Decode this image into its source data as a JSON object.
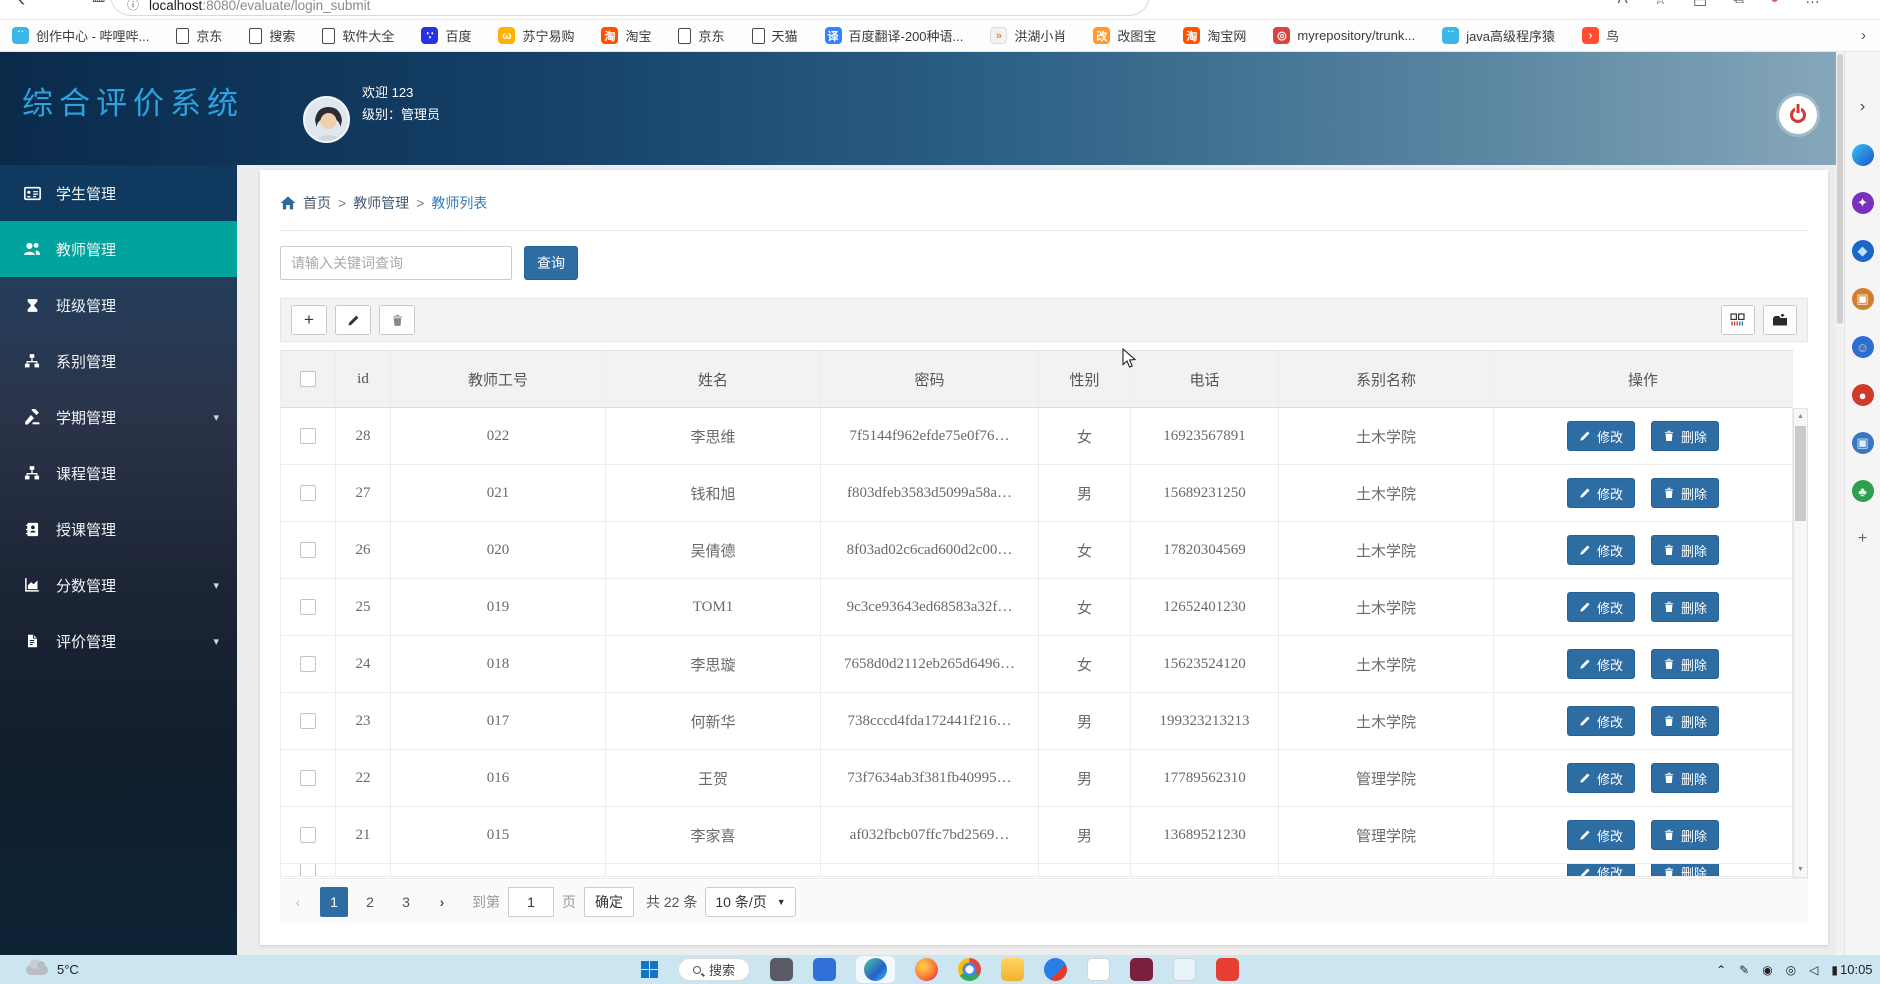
{
  "browser": {
    "url_host": "localhost",
    "url_rest": ":8080/evaluate/login_submit",
    "bookmarks": [
      {
        "label": "创作中心 - 哔哩哔...",
        "icon": "bilibili",
        "bg": "#3bb7e6",
        "glyph": "˙˙"
      },
      {
        "label": "京东",
        "icon": "page",
        "bg": "",
        "glyph": ""
      },
      {
        "label": "搜索",
        "icon": "page",
        "bg": "",
        "glyph": ""
      },
      {
        "label": "软件大全",
        "icon": "page",
        "bg": "",
        "glyph": ""
      },
      {
        "label": "百度",
        "icon": "baidu-paw",
        "bg": "#2932e1",
        "glyph": "∵"
      },
      {
        "label": "苏宁易购",
        "icon": "suning-lion",
        "bg": "#ffb300",
        "glyph": "ω"
      },
      {
        "label": "淘宝",
        "icon": "taobao",
        "bg": "#ff5000",
        "glyph": "淘"
      },
      {
        "label": "京东",
        "icon": "page",
        "bg": "",
        "glyph": ""
      },
      {
        "label": "天猫",
        "icon": "page",
        "bg": "",
        "glyph": ""
      },
      {
        "label": "百度翻译-200种语...",
        "icon": "translate",
        "bg": "#3385ff",
        "glyph": "译"
      },
      {
        "label": "洪湖小肖",
        "icon": "goose",
        "bg": "#f2f2f2",
        "glyph": "»"
      },
      {
        "label": "改图宝",
        "icon": "gaitubao",
        "bg": "#ff9a2e",
        "glyph": "改"
      },
      {
        "label": "淘宝网",
        "icon": "taobao",
        "bg": "#ff5000",
        "glyph": "淘"
      },
      {
        "label": "myrepository/trunk...",
        "icon": "sphere",
        "bg": "#d8453c",
        "glyph": "◎"
      },
      {
        "label": "java高级程序猿",
        "icon": "bilibili",
        "bg": "#3bb7e6",
        "glyph": "˙˙"
      },
      {
        "label": "鸟",
        "icon": "bird",
        "bg": "#ff4d2e",
        "glyph": "›"
      }
    ],
    "overflow_chevron": "›",
    "top_icons": [
      "A",
      "☆",
      "⬒",
      "⧉",
      "●",
      "…"
    ]
  },
  "header": {
    "title": "综合评价系统",
    "welcome": "欢迎 123",
    "level": "级别：管理员"
  },
  "sidebar": {
    "items": [
      {
        "label": "学生管理",
        "icon": "idcard",
        "style": "navy",
        "caret": false
      },
      {
        "label": "教师管理",
        "icon": "users",
        "style": "active",
        "caret": false
      },
      {
        "label": "班级管理",
        "icon": "hourglass",
        "style": "",
        "caret": false
      },
      {
        "label": "系别管理",
        "icon": "sitemap",
        "style": "",
        "caret": false
      },
      {
        "label": "学期管理",
        "icon": "gavel",
        "style": "",
        "caret": true
      },
      {
        "label": "课程管理",
        "icon": "sitemap",
        "style": "",
        "caret": false
      },
      {
        "label": "授课管理",
        "icon": "addressbook",
        "style": "",
        "caret": false
      },
      {
        "label": "分数管理",
        "icon": "chart",
        "style": "",
        "caret": true
      },
      {
        "label": "评价管理",
        "icon": "file",
        "style": "",
        "caret": true
      }
    ]
  },
  "page": {
    "breadcrumb": {
      "items": [
        "首页",
        "教师管理",
        "教师列表"
      ],
      "separator": ">"
    },
    "search": {
      "placeholder": "请输入关键词查询",
      "button": "查询"
    },
    "table": {
      "columns": [
        "",
        "id",
        "教师工号",
        "姓名",
        "密码",
        "性别",
        "电话",
        "系别名称",
        "操作"
      ],
      "rows": [
        {
          "id": "28",
          "work_no": "022",
          "name": "李思维",
          "password": "7f5144f962efde75e0f76…",
          "gender": "女",
          "phone": "16923567891",
          "dept": "土木学院"
        },
        {
          "id": "27",
          "work_no": "021",
          "name": "钱和旭",
          "password": "f803dfeb3583d5099a58a…",
          "gender": "男",
          "phone": "15689231250",
          "dept": "土木学院"
        },
        {
          "id": "26",
          "work_no": "020",
          "name": "吴倩德",
          "password": "8f03ad02c6cad600d2c00…",
          "gender": "女",
          "phone": "17820304569",
          "dept": "土木学院"
        },
        {
          "id": "25",
          "work_no": "019",
          "name": "TOM1",
          "password": "9c3ce93643ed68583a32f…",
          "gender": "女",
          "phone": "12652401230",
          "dept": "土木学院"
        },
        {
          "id": "24",
          "work_no": "018",
          "name": "李思璇",
          "password": "7658d0d2112eb265d6496…",
          "gender": "女",
          "phone": "15623524120",
          "dept": "土木学院"
        },
        {
          "id": "23",
          "work_no": "017",
          "name": "何新华",
          "password": "738cccd4fda172441f216…",
          "gender": "男",
          "phone": "199323213213",
          "dept": "土木学院"
        },
        {
          "id": "22",
          "work_no": "016",
          "name": "王贺",
          "password": "73f7634ab3f381fb40995…",
          "gender": "男",
          "phone": "17789562310",
          "dept": "管理学院"
        },
        {
          "id": "21",
          "work_no": "015",
          "name": "李家喜",
          "password": "af032fbcb07ffc7bd2569…",
          "gender": "男",
          "phone": "13689521230",
          "dept": "管理学院"
        }
      ],
      "actions": {
        "edit": "修改",
        "delete": "删除"
      }
    },
    "pagination": {
      "prev": "‹",
      "next": "›",
      "pages": [
        "1",
        "2",
        "3"
      ],
      "active": "1",
      "goto_label": "到第",
      "goto_value": "1",
      "unit_label": "页",
      "confirm": "确定",
      "total": "共 22 条",
      "per_page": "10 条/页"
    }
  },
  "edge_rail": [
    {
      "name": "rail-collapse-icon",
      "glyph": "›",
      "bg": "transparent",
      "fg": "#444"
    },
    {
      "name": "copilot-icon",
      "glyph": "",
      "bg": "linear-gradient(135deg,#35c1f1,#2052cb)",
      "fg": "#fff"
    },
    {
      "name": "m365-copilot-icon",
      "glyph": "✦",
      "bg": "#7b2fbe",
      "fg": "#fff"
    },
    {
      "name": "edge-workspaces-icon",
      "glyph": "◆",
      "bg": "#1b66c9",
      "fg": "#bfe0ff"
    },
    {
      "name": "toolbox-icon",
      "glyph": "▣",
      "bg": "#d07f2f",
      "fg": "#fff"
    },
    {
      "name": "games-icon",
      "glyph": "☺",
      "bg": "#2d6fd0",
      "fg": "#ffd34d"
    },
    {
      "name": "shopping-icon",
      "glyph": "●",
      "bg": "#d03a2b",
      "fg": "#ffffff"
    },
    {
      "name": "screenshot-icon",
      "glyph": "▣",
      "bg": "#3a77c2",
      "fg": "#dfeeff"
    },
    {
      "name": "tree-icon",
      "glyph": "♣",
      "bg": "#2e9e4f",
      "fg": "#eaffe9"
    },
    {
      "name": "add-rail-icon",
      "glyph": "+",
      "bg": "transparent",
      "fg": "#666"
    }
  ],
  "taskbar": {
    "weather": "5°C",
    "search_label": "搜索",
    "clock": "10:05",
    "apps": [
      {
        "name": "app-dark",
        "bg": "#5a5a66",
        "pill": false
      },
      {
        "name": "app-blue-mail",
        "bg": "#2f6fd6",
        "pill": false
      },
      {
        "name": "edge-browser",
        "bg": "linear-gradient(135deg,#4ec9a6,#2461c7 60%,#35c1f1)",
        "pill": true,
        "round": true
      },
      {
        "name": "firefox",
        "bg": "radial-gradient(circle at 35% 35%,#ffd54d,#ff7139 60%,#b5007f)",
        "pill": false,
        "round": true
      },
      {
        "name": "chrome",
        "bg": "conic-gradient(#ea4335 0 33%,#34a853 33% 66%,#fbbc05 66% 100%)",
        "pill": false,
        "round": true,
        "chrome": true
      },
      {
        "name": "file-explorer",
        "bg": "linear-gradient(180deg,#ffd661,#f3b02f)",
        "pill": false
      },
      {
        "name": "app-blue-red",
        "bg": "linear-gradient(135deg,#2b7de9 60%,#e23b2e 60%)",
        "pill": false,
        "round": true
      },
      {
        "name": "app-store",
        "bg": "#ffffff",
        "pill": false,
        "border": true
      },
      {
        "name": "app-maroon",
        "bg": "#7a1f3d",
        "pill": false
      },
      {
        "name": "app-notes",
        "bg": "#e8f2fb",
        "pill": false,
        "border": true
      },
      {
        "name": "app-red-v",
        "bg": "#e63e30",
        "pill": false
      }
    ],
    "tray": [
      {
        "name": "tray-expand-icon",
        "glyph": "⌃"
      },
      {
        "name": "tray-pen-icon",
        "glyph": "✎"
      },
      {
        "name": "tray-person-icon",
        "glyph": "◉"
      },
      {
        "name": "tray-eye-icon",
        "glyph": "◎"
      },
      {
        "name": "tray-volume-icon",
        "glyph": "◁"
      },
      {
        "name": "tray-battery-icon",
        "glyph": "▮"
      }
    ]
  },
  "colors": {
    "primary": "#2e6da4",
    "active_menu": "#00a49c",
    "header_title": "#2ba3e0"
  }
}
